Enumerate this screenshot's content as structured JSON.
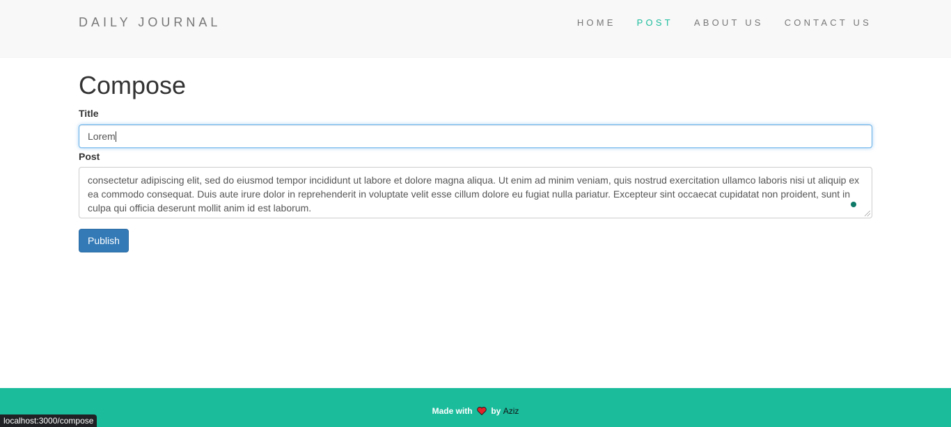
{
  "navbar": {
    "brand": "DAILY JOURNAL",
    "links": [
      {
        "label": "HOME",
        "active": false
      },
      {
        "label": "POST",
        "active": true
      },
      {
        "label": "ABOUT US",
        "active": false
      },
      {
        "label": "CONTACT US",
        "active": false
      }
    ]
  },
  "compose": {
    "heading": "Compose",
    "title_label": "Title",
    "title_value": "Lorem",
    "post_label": "Post",
    "post_value": "consectetur adipiscing elit, sed do eiusmod tempor incididunt ut labore et dolore magna aliqua. Ut enim ad minim veniam, quis nostrud exercitation ullamco laboris nisi ut aliquip ex ea commodo consequat. Duis aute irure dolor in reprehenderit in voluptate velit esse cillum dolore eu fugiat nulla pariatur. Excepteur sint occaecat cupidatat non proident, sunt in culpa qui officia deserunt mollit anim id est laborum.",
    "publish_label": "Publish"
  },
  "footer": {
    "made_with": "Made with",
    "heart_icon": "heart-icon",
    "by": "by",
    "author": "Aziz"
  },
  "status_bar": {
    "url": "localhost:3000/compose"
  },
  "colors": {
    "accent": "#1abc9c",
    "button": "#337ab7",
    "navbar_bg": "#f8f8f8"
  }
}
